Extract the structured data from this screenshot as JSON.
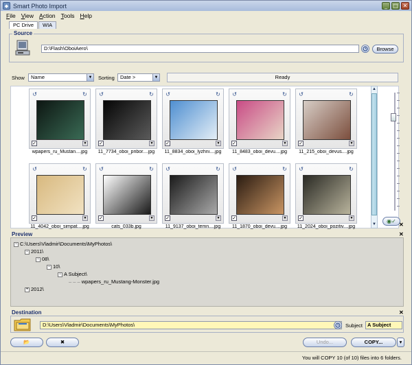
{
  "window": {
    "title": "Smart Photo Import",
    "controls": [
      "_",
      "□",
      "✕"
    ]
  },
  "menu": [
    "File",
    "View",
    "Action",
    "Tools",
    "Help"
  ],
  "tabs": [
    {
      "label": "PC Drive",
      "active": true
    },
    {
      "label": "WIA",
      "active": false
    }
  ],
  "source": {
    "title": "Source",
    "path": "D:\\Flash\\OboiAero\\",
    "browse_label": "Browse"
  },
  "toolbar": {
    "show_label": "Show",
    "show_value": "Name",
    "sorting_label": "Sorting",
    "sorting_value": "Date >",
    "status": "Ready"
  },
  "photos": [
    {
      "caption": "wpapers_ru_Mustan....jpg",
      "checked": true,
      "colors": [
        "#0d1612",
        "#3a6b55"
      ]
    },
    {
      "caption": "11_7734_oboi_pribor....jpg",
      "checked": true,
      "colors": [
        "#060606",
        "#5a5a5a"
      ]
    },
    {
      "caption": "11_8834_oboi_lyzhni....jpg",
      "checked": true,
      "colors": [
        "#4f8fd1",
        "#e4eef6"
      ]
    },
    {
      "caption": "11_8483_oboi_devu....jpg",
      "checked": true,
      "colors": [
        "#c94c86",
        "#e8d5c6"
      ]
    },
    {
      "caption": "11_215_oboi_devus....jpg",
      "checked": true,
      "colors": [
        "#d7cdc6",
        "#7c4f3e"
      ]
    },
    {
      "caption": "11_4042_oboi_simpat....jpg",
      "checked": true,
      "colors": [
        "#d8b97f",
        "#f1e2c2"
      ]
    },
    {
      "caption": "cats_033b.jpg",
      "checked": true,
      "colors": [
        "#ffffff",
        "#1a1a1a"
      ]
    },
    {
      "caption": "11_9137_oboi_temn....jpg",
      "checked": true,
      "colors": [
        "#1b1b1b",
        "#a9a9a9"
      ]
    },
    {
      "caption": "11_1870_oboi_devu....jpg",
      "checked": true,
      "colors": [
        "#2b1c12",
        "#c99563"
      ]
    },
    {
      "caption": "11_2024_oboi_pozitiv....jpg",
      "checked": true,
      "colors": [
        "#2a2a24",
        "#b8b39c"
      ]
    }
  ],
  "preview": {
    "title": "Preview",
    "tree": [
      {
        "label": "C:\\Users\\Vladmir\\Documents\\MyPhotos\\",
        "depth": 0,
        "box": "−"
      },
      {
        "label": "2011\\",
        "depth": 1,
        "box": "−"
      },
      {
        "label": "08\\",
        "depth": 2,
        "box": "−"
      },
      {
        "label": "10\\",
        "depth": 3,
        "box": "−"
      },
      {
        "label": "A Subject\\",
        "depth": 4,
        "box": "−"
      },
      {
        "label": "wpapers_ru_Mustang-Monster.jpg",
        "depth": 5,
        "box": ""
      },
      {
        "label": "2012\\",
        "depth": 1,
        "box": "+"
      }
    ]
  },
  "destination": {
    "title": "Destination",
    "path": "D:\\Users\\Vladmir\\Documents\\MyPhotos\\",
    "subject_label": "Subject",
    "subject_value": "A Subject"
  },
  "actions": {
    "undo_label": "Undo...",
    "copy_label": "COPY..."
  },
  "status_message": "You will COPY 10 (of 10) files into 6 folders."
}
